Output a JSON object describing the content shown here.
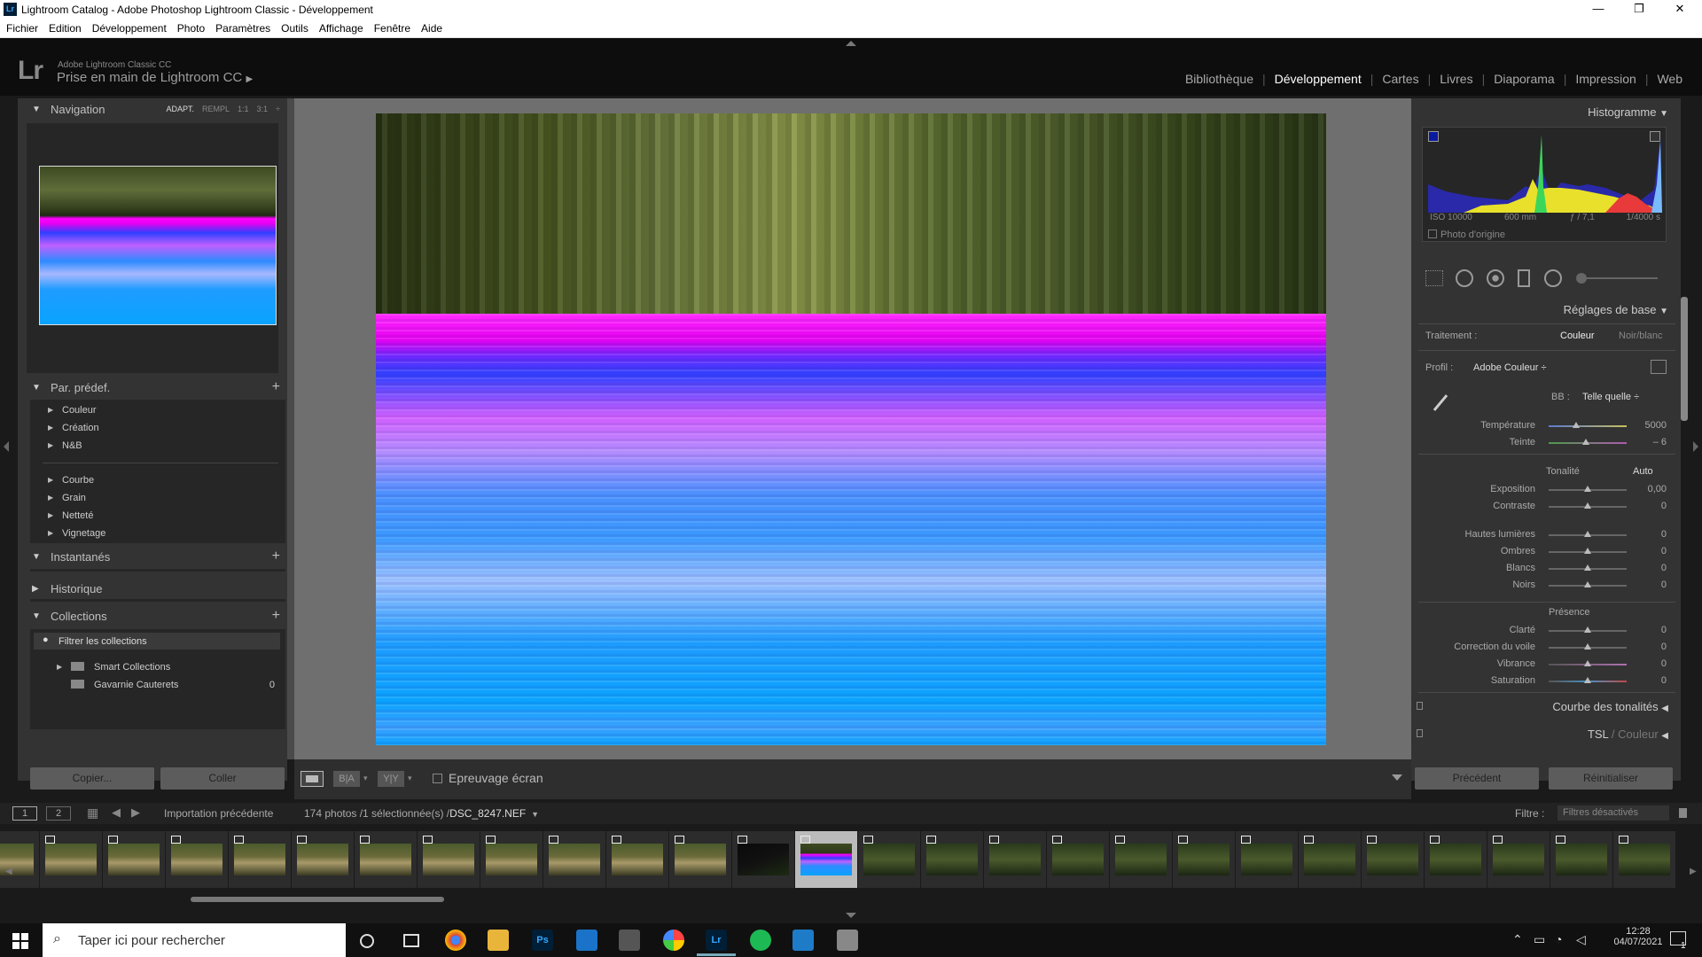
{
  "window": {
    "title": "Lightroom Catalog - Adobe Photoshop Lightroom Classic - Développement",
    "app_icon": "Lr"
  },
  "menu": [
    "Fichier",
    "Edition",
    "Développement",
    "Photo",
    "Paramètres",
    "Outils",
    "Affichage",
    "Fenêtre",
    "Aide"
  ],
  "identity": {
    "logo": "Lr",
    "product": "Adobe Lightroom Classic CC",
    "title": "Prise en main de Lightroom CC",
    "arrow": "▶"
  },
  "modules": [
    {
      "label": "Bibliothèque",
      "active": false
    },
    {
      "label": "Développement",
      "active": true
    },
    {
      "label": "Cartes",
      "active": false
    },
    {
      "label": "Livres",
      "active": false
    },
    {
      "label": "Diaporama",
      "active": false
    },
    {
      "label": "Impression",
      "active": false
    },
    {
      "label": "Web",
      "active": false
    }
  ],
  "left": {
    "navigation": {
      "title": "Navigation",
      "zoom": [
        "ADAPT.",
        "REMPL",
        "1:1",
        "3:1"
      ],
      "active_zoom": "ADAPT."
    },
    "presets": {
      "title": "Par. prédef.",
      "items": [
        "Couleur",
        "Création",
        "N&B",
        "Courbe",
        "Grain",
        "Netteté",
        "Vignetage"
      ]
    },
    "snapshots": {
      "title": "Instantanés"
    },
    "history": {
      "title": "Historique"
    },
    "collections": {
      "title": "Collections",
      "filter": "Filtrer les collections",
      "items": [
        {
          "label": "Smart Collections",
          "count": ""
        },
        {
          "label": "Gavarnie Cauterets",
          "count": "0"
        }
      ]
    },
    "copy_button": "Copier...",
    "paste_button": "Coller"
  },
  "toolbar": {
    "softproof": "Epreuvage écran",
    "view_ba": "B|A",
    "view_yy": "Y|Y"
  },
  "right": {
    "histogram": {
      "title": "Histogramme",
      "iso": "ISO 10000",
      "focal": "600 mm",
      "aperture": "ƒ / 7,1",
      "shutter": "1/4000 s",
      "original": "Photo d'origine"
    },
    "basic": {
      "title": "Réglages de base",
      "treatment_label": "Traitement :",
      "treatment_color": "Couleur",
      "treatment_bw": "Noir/blanc",
      "profile_label": "Profil :",
      "profile_value": "Adobe Couleur ÷",
      "wb_label": "BB :",
      "wb_value": "Telle quelle ÷",
      "tone_label": "Tonalité",
      "auto_label": "Auto",
      "presence_label": "Présence",
      "sliders": [
        {
          "label": "Température",
          "value": "5000",
          "level": 0.35
        },
        {
          "label": "Teinte",
          "value": "– 6",
          "level": 0.48
        },
        {
          "label": "Exposition",
          "value": "0,00",
          "level": 0.5
        },
        {
          "label": "Contraste",
          "value": "0",
          "level": 0.5
        },
        {
          "label": "Hautes lumières",
          "value": "0",
          "level": 0.5
        },
        {
          "label": "Ombres",
          "value": "0",
          "level": 0.5
        },
        {
          "label": "Blancs",
          "value": "0",
          "level": 0.5
        },
        {
          "label": "Noirs",
          "value": "0",
          "level": 0.5
        },
        {
          "label": "Clarté",
          "value": "0",
          "level": 0.5
        },
        {
          "label": "Correction du voile",
          "value": "0",
          "level": 0.5
        },
        {
          "label": "Vibrance",
          "value": "0",
          "level": 0.5
        },
        {
          "label": "Saturation",
          "value": "0",
          "level": 0.5
        }
      ]
    },
    "tone_curve": {
      "title": "Courbe des tonalités"
    },
    "hsl": {
      "title": "TSL",
      "subtitle": " / Couleur"
    },
    "prev_button": "Précédent",
    "reset_button": "Réinitialiser"
  },
  "filmbar": {
    "page1": "1",
    "page2": "2",
    "source": "Importation précédente",
    "count": "174 photos /1 sélectionnée(s) /",
    "filename": "DSC_8247.NEF",
    "filter_label": "Filtre :",
    "filter_value": "Filtres désactivés"
  },
  "taskbar": {
    "search": "Taper ici pour rechercher",
    "time": "12:28",
    "date": "04/07/2021",
    "notif": "1"
  },
  "colors": {
    "accent_magenta": "#ff00ff",
    "accent_blue": "#0aa3ff",
    "panel": "#333333",
    "bg": "#1a1a1a"
  }
}
